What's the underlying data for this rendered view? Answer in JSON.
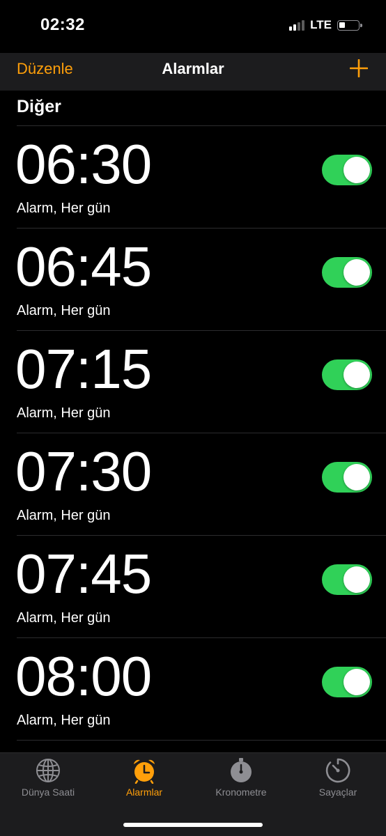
{
  "status_bar": {
    "time": "02:32",
    "network": "LTE",
    "battery_level": 0.2
  },
  "nav": {
    "edit_label": "Düzenle",
    "title": "Alarmlar",
    "add_icon": "plus-icon"
  },
  "section": {
    "title": "Diğer"
  },
  "alarms": [
    {
      "time": "06:30",
      "label": "Alarm, Her gün",
      "enabled": true
    },
    {
      "time": "06:45",
      "label": "Alarm, Her gün",
      "enabled": true
    },
    {
      "time": "07:15",
      "label": "Alarm, Her gün",
      "enabled": true
    },
    {
      "time": "07:30",
      "label": "Alarm, Her gün",
      "enabled": true
    },
    {
      "time": "07:45",
      "label": "Alarm, Her gün",
      "enabled": true
    },
    {
      "time": "08:00",
      "label": "Alarm, Her gün",
      "enabled": true
    }
  ],
  "tabs": [
    {
      "label": "Dünya Saati",
      "icon": "globe-icon",
      "active": false
    },
    {
      "label": "Alarmlar",
      "icon": "alarm-clock-icon",
      "active": true
    },
    {
      "label": "Kronometre",
      "icon": "stopwatch-icon",
      "active": false
    },
    {
      "label": "Sayaçlar",
      "icon": "timer-icon",
      "active": false
    }
  ],
  "colors": {
    "accent": "#ff9f0a",
    "toggle_on": "#30d158",
    "background": "#000000",
    "bar_background": "#1c1c1e",
    "inactive_tab": "#8e8e93"
  }
}
